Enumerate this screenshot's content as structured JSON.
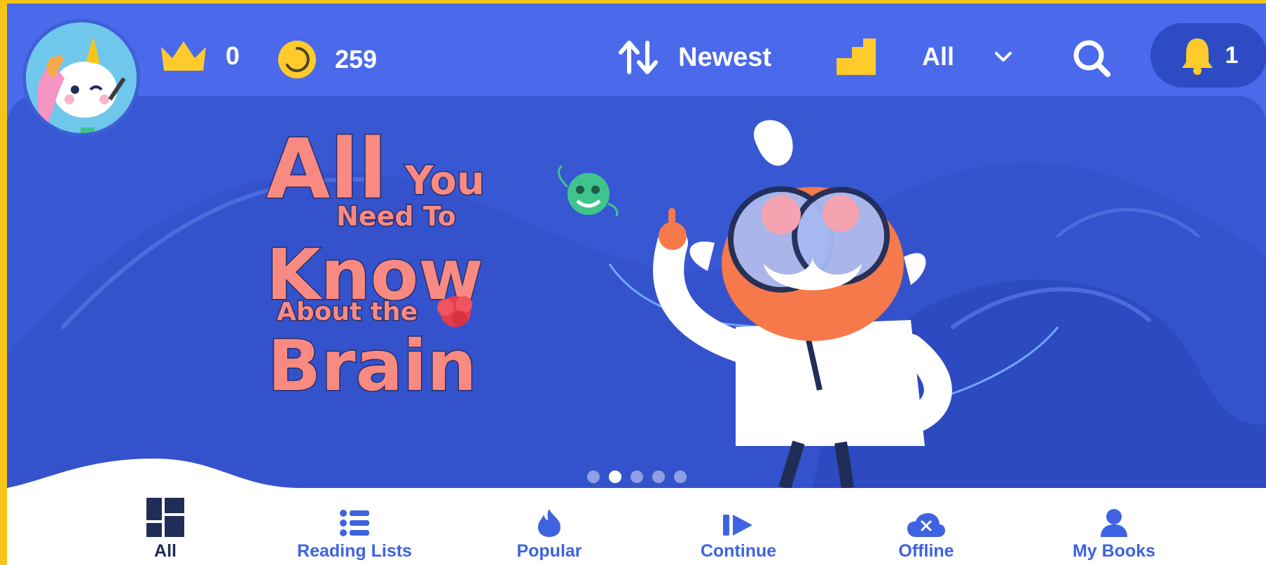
{
  "header": {
    "crowns": {
      "icon": "crown-icon",
      "value": "0"
    },
    "coins": {
      "icon": "coin-icon",
      "value": "259"
    },
    "sort": {
      "icon": "sort-arrows-icon",
      "label": "Newest"
    },
    "level_filter": {
      "icon": "level-stairs-icon",
      "label": "All",
      "chevron": "chevron-down-icon"
    },
    "search": {
      "icon": "search-icon"
    },
    "notifications": {
      "icon": "bell-icon",
      "count": "1"
    },
    "avatar": {
      "icon": "unicorn-avatar"
    }
  },
  "banner": {
    "slides_total": 5,
    "active_slide": 2
  },
  "bottom_nav": {
    "active": "all",
    "items": [
      {
        "key": "all",
        "label": "All",
        "icon": "grid-icon"
      },
      {
        "key": "reading-lists",
        "label": "Reading Lists",
        "icon": "list-icon"
      },
      {
        "key": "popular",
        "label": "Popular",
        "icon": "fire-icon"
      },
      {
        "key": "continue",
        "label": "Continue",
        "icon": "play-next-icon"
      },
      {
        "key": "offline",
        "label": "Offline",
        "icon": "cloud-off-icon"
      },
      {
        "key": "my-books",
        "label": "My Books",
        "icon": "user-icon"
      }
    ]
  },
  "colors": {
    "frame": "#f7c51a",
    "app_blue": "#4a6aeb",
    "banner_blue": "#3857d2",
    "accent_yellow": "#ffcb2b",
    "title_pink": "#f98a82",
    "nav_label": "#3f63e0",
    "nav_active": "#1f2d57"
  }
}
